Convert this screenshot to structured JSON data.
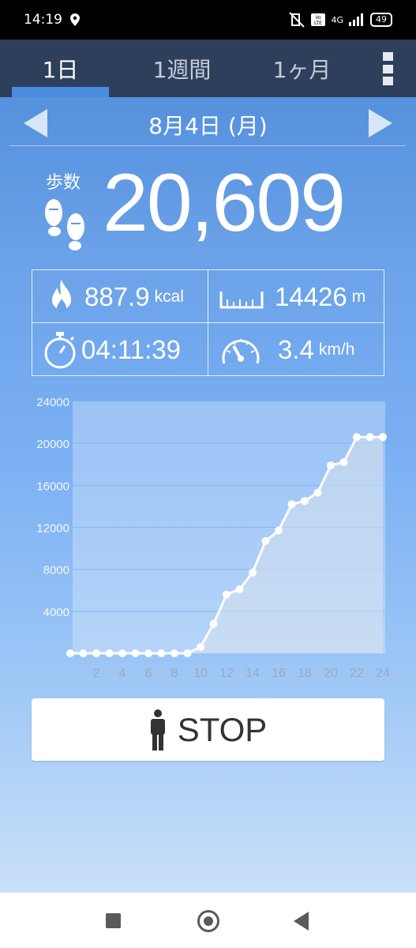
{
  "status_bar": {
    "time": "14:19",
    "battery": "49",
    "network": "4G"
  },
  "tabs": [
    {
      "label": "1日"
    },
    {
      "label": "1週間"
    },
    {
      "label": "1ヶ月"
    }
  ],
  "date": {
    "label": "8月4日 (月)"
  },
  "steps": {
    "label": "歩数",
    "value": "20,609"
  },
  "stats": {
    "calories": {
      "value": "887.9",
      "unit": "kcal"
    },
    "distance": {
      "value": "14426",
      "unit": "m"
    },
    "time": {
      "value": "04:11:39"
    },
    "speed": {
      "value": "3.4",
      "unit": "km/h"
    }
  },
  "stop_button": {
    "label": "STOP"
  },
  "colors": {
    "tab_bar": "#2e3f5c",
    "accent": "#4a8ce0"
  },
  "chart_data": {
    "type": "line",
    "x": [
      0,
      1,
      2,
      3,
      4,
      5,
      6,
      7,
      8,
      9,
      10,
      11,
      12,
      13,
      14,
      15,
      16,
      17,
      18,
      19,
      20,
      21,
      22,
      23,
      24
    ],
    "y": [
      0,
      0,
      0,
      0,
      0,
      0,
      0,
      0,
      0,
      0,
      600,
      2800,
      5600,
      6100,
      7700,
      10700,
      11700,
      14200,
      14500,
      15300,
      17900,
      18200,
      20600,
      20600,
      20600
    ],
    "xticks": [
      "2",
      "4",
      "6",
      "8",
      "10",
      "12",
      "14",
      "16",
      "18",
      "20",
      "22",
      "24"
    ],
    "yticks": [
      "4000",
      "8000",
      "12000",
      "16000",
      "20000",
      "24000"
    ],
    "ylim": [
      0,
      24000
    ],
    "xlim": [
      0,
      24
    ],
    "grid": true
  }
}
